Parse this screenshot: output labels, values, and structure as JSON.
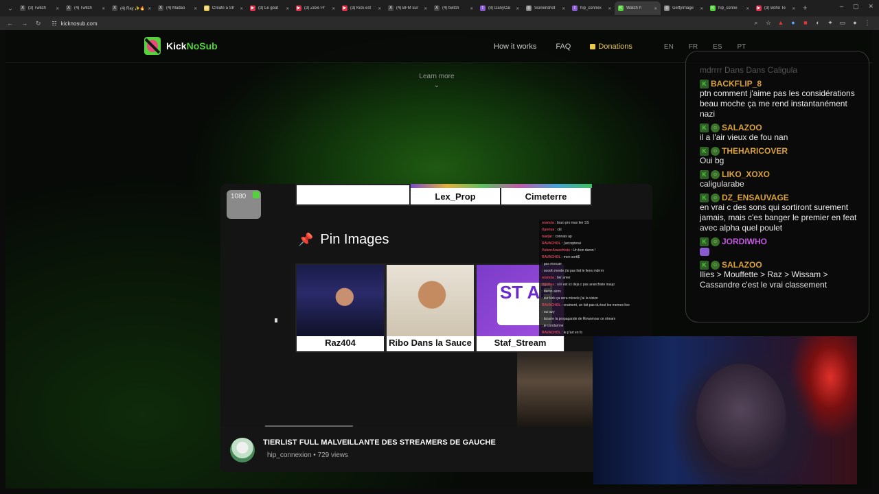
{
  "browser": {
    "tabs": [
      {
        "title": "(3) Twitch",
        "icon": "x-icon"
      },
      {
        "title": "(4) Twitch",
        "icon": "x-icon"
      },
      {
        "title": "(4) Ray ✨🔥",
        "icon": "x-icon"
      },
      {
        "title": "(4) Madao",
        "icon": "x-icon"
      },
      {
        "title": "Create a Sh",
        "icon": "doc-icon"
      },
      {
        "title": "(3) Le goat",
        "icon": "youtube-icon"
      },
      {
        "title": "(3) Zoxe Pr",
        "icon": "youtube-icon"
      },
      {
        "title": "(3) Kick est",
        "icon": "youtube-icon"
      },
      {
        "title": "(4) BFM sur",
        "icon": "x-icon"
      },
      {
        "title": "(4) twitch",
        "icon": "x-icon"
      },
      {
        "title": "(8) DanyCal",
        "icon": "twitch-icon"
      },
      {
        "title": "Screenshot",
        "icon": "globe-icon"
      },
      {
        "title": "hip_connex",
        "icon": "twitch-icon"
      },
      {
        "title": "Watch h",
        "icon": "kick-icon"
      },
      {
        "title": "GettyImage",
        "icon": "globe-icon"
      },
      {
        "title": "hip_conne",
        "icon": "kick-icon"
      },
      {
        "title": "(3) Boho Te",
        "icon": "youtube-icon"
      }
    ],
    "active_tab_index": 13,
    "url": "kicknosub.com"
  },
  "site": {
    "logo": {
      "part1": "Kick",
      "part2": "NoSub"
    },
    "nav": {
      "how": "How it works",
      "faq": "FAQ",
      "donations": "Donations"
    },
    "langs": [
      "EN",
      "FR",
      "ES",
      "PT"
    ],
    "learn_more": "Learn more",
    "accent": "#53d23c",
    "donate_color": "#e8c845"
  },
  "video": {
    "badge": "1080",
    "slide": {
      "top_cells": [
        "",
        "Lex_Prop",
        "Cimeterre"
      ],
      "pin_title": "Pin Images",
      "thumbs": [
        "Raz404",
        "Ribo Dans la Sauce",
        "Staf_Stream"
      ],
      "staf_logo": "ST AF"
    },
    "chat_overlay": [
      {
        "u": "orancia",
        "t": "bozo pro max tier SS"
      },
      {
        "u": "Xperius",
        "t": "ckl"
      },
      {
        "u": "tsarjar",
        "t": "connais ap"
      },
      {
        "u": "RAVACHOL",
        "t": "j'accepterai"
      },
      {
        "u": "VulenrAnarchiste",
        "t": "Un bon daron !"
      },
      {
        "u": "RAVACHOL",
        "t": "mon sorti$"
      },
      {
        "u": "",
        "t": "gas morcae"
      },
      {
        "u": "",
        "t": "ooooh merde j'ai pas fait le liens mdrrrrr"
      },
      {
        "u": "orancia",
        "t": "tier amer"
      },
      {
        "u": "tigerius",
        "t": "si il est ici deja c pas anarchiste inaup"
      },
      {
        "u": "",
        "t": "daron alors"
      },
      {
        "u": "",
        "t": "sur kick ça sera miracle j'ai la vision"
      },
      {
        "u": "RAVACHOL",
        "t": "vraiment, un fait pas du tout les memes live"
      },
      {
        "u": "",
        "t": "oui azy"
      },
      {
        "u": "",
        "t": "bizarre la propagande de Rivanmour ce stream"
      },
      {
        "u": "",
        "t": "je condamne"
      },
      {
        "u": "RAVACHOL",
        "t": "le p'art en fo"
      }
    ],
    "title": "TIERLIST FULL MALVEILLANTE DES STREAMERS DE GAUCHE",
    "channel": "hip_connexion",
    "views": "729 views"
  },
  "chat": {
    "partial_top": "mdrrrr Dans Dans Caligula",
    "messages": [
      {
        "user": "BACKFLIP_8",
        "text": "ptn comment j'aime pas les considérations beau moche ça me rend instantanément nazi",
        "emote_badge": false,
        "color": "#d9a23a"
      },
      {
        "user": "SALAZOO",
        "text": "il a l'air vieux de fou nan",
        "emote_badge": true,
        "color": "#d9a23a"
      },
      {
        "user": "THEHARICOVER",
        "text": "Oui bg",
        "emote_badge": true,
        "color": "#d9a23a"
      },
      {
        "user": "LIKO_XOXO",
        "text": "caligularabe",
        "emote_badge": true,
        "color": "#d9a23a"
      },
      {
        "user": "DZ_ENSAUVAGE",
        "text": "en vrai c des sons qui sortiront surement jamais, mais c'es banger le premier en feat avec alpha quel poulet",
        "emote_badge": true,
        "color": "#d9a23a"
      },
      {
        "user": "JORDIWHO",
        "text": "",
        "emote_badge": true,
        "color": "#c25ae0"
      },
      {
        "user": "SALAZOO",
        "text": "Ilies > Mouffette > Raz > Wissam > Cassandre c'est le vrai classement",
        "emote_badge": true,
        "color": "#d9a23a"
      }
    ]
  }
}
